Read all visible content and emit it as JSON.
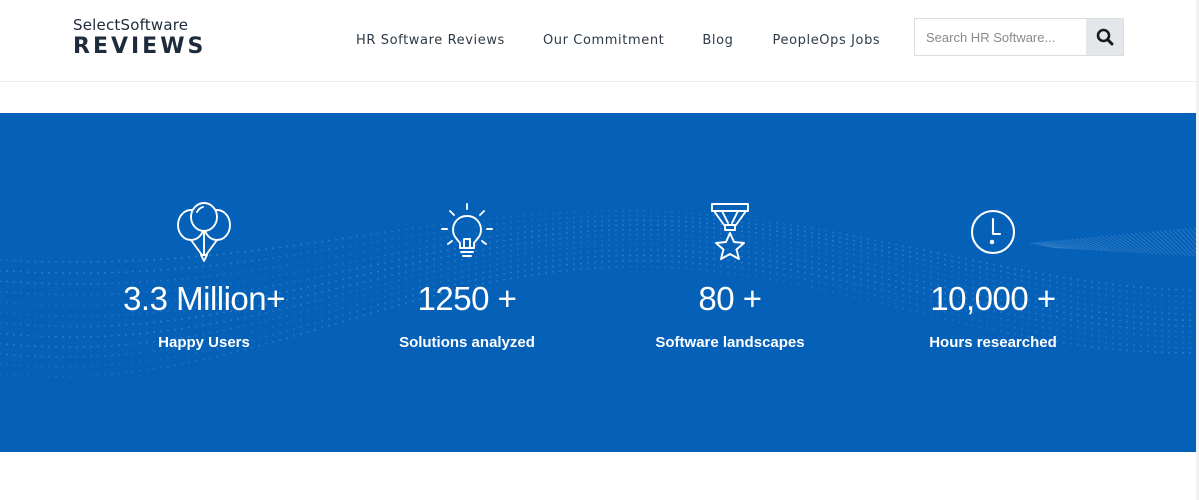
{
  "brand": {
    "line1": "SelectSoftware",
    "line2": "REVIEWS"
  },
  "nav": {
    "items": [
      {
        "label": "HR Software Reviews"
      },
      {
        "label": "Our Commitment"
      },
      {
        "label": "Blog"
      },
      {
        "label": "PeopleOps Jobs"
      }
    ]
  },
  "search": {
    "placeholder": "Search HR Software...",
    "value": "",
    "icon": "search-icon"
  },
  "stats": {
    "background_color": "#0561b8",
    "items": [
      {
        "icon": "balloons-icon",
        "value": "3.3 Million+",
        "label": "Happy Users"
      },
      {
        "icon": "lightbulb-icon",
        "value": "1250 +",
        "label": "Solutions analyzed"
      },
      {
        "icon": "medal-star-icon",
        "value": "80 +",
        "label": "Software landscapes"
      },
      {
        "icon": "clock-icon",
        "value": "10,000 +",
        "label": "Hours researched"
      }
    ]
  }
}
